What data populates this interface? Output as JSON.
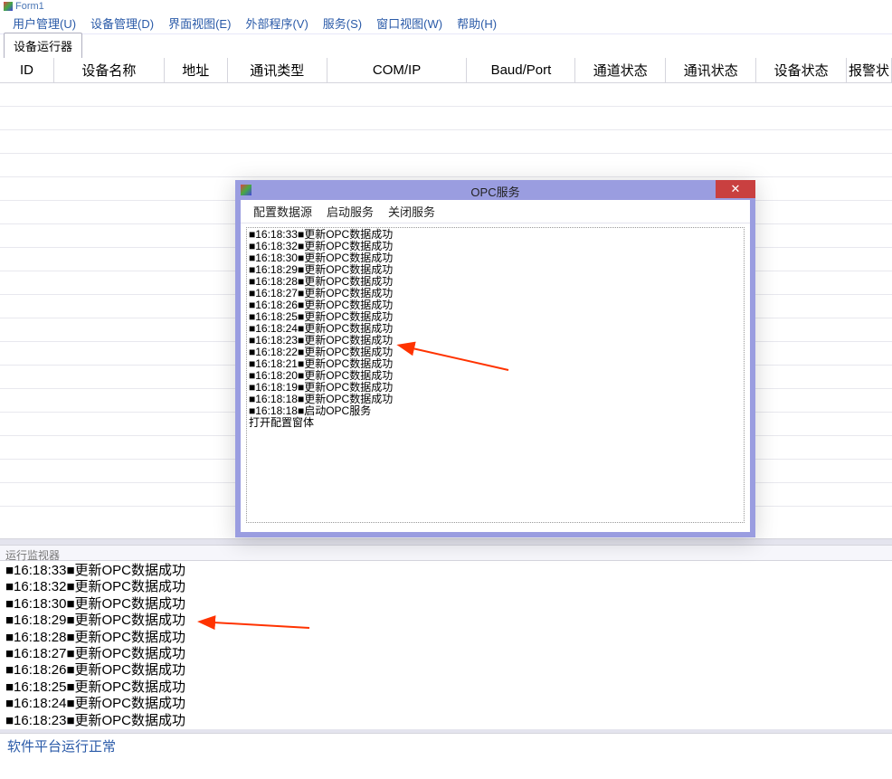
{
  "window_title": "Form1",
  "menus": [
    "用户管理(U)",
    "设备管理(D)",
    "界面视图(E)",
    "外部程序(V)",
    "服务(S)",
    "窗口视图(W)",
    "帮助(H)"
  ],
  "tabs": [
    {
      "label": "设备运行器"
    }
  ],
  "grid": {
    "columns": [
      "ID",
      "设备名称",
      "地址",
      "通讯类型",
      "COM/IP",
      "Baud/Port",
      "通道状态",
      "通讯状态",
      "设备状态",
      "报警状"
    ]
  },
  "opc_dialog": {
    "title": "OPC服务",
    "menus": [
      "配置数据源",
      "启动服务",
      "关闭服务"
    ],
    "log_lines": [
      "■16:18:33■更新OPC数据成功",
      "■16:18:32■更新OPC数据成功",
      "■16:18:30■更新OPC数据成功",
      "■16:18:29■更新OPC数据成功",
      "■16:18:28■更新OPC数据成功",
      "■16:18:27■更新OPC数据成功",
      "■16:18:26■更新OPC数据成功",
      "■16:18:25■更新OPC数据成功",
      "■16:18:24■更新OPC数据成功",
      "■16:18:23■更新OPC数据成功",
      "■16:18:22■更新OPC数据成功",
      "■16:18:21■更新OPC数据成功",
      "■16:18:20■更新OPC数据成功",
      "■16:18:19■更新OPC数据成功",
      "■16:18:18■更新OPC数据成功",
      "■16:18:18■启动OPC服务",
      "打开配置窗体"
    ]
  },
  "run_monitor": {
    "title": "运行监视器",
    "lines": [
      "■16:18:33■更新OPC数据成功",
      "■16:18:32■更新OPC数据成功",
      "■16:18:30■更新OPC数据成功",
      "■16:18:29■更新OPC数据成功",
      "■16:18:28■更新OPC数据成功",
      "■16:18:27■更新OPC数据成功",
      "■16:18:26■更新OPC数据成功",
      "■16:18:25■更新OPC数据成功",
      "■16:18:24■更新OPC数据成功",
      "■16:18:23■更新OPC数据成功"
    ]
  },
  "status_text": "软件平台运行正常"
}
